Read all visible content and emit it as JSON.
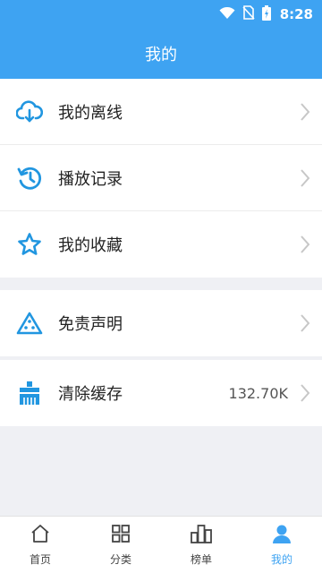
{
  "status": {
    "time": "8:28"
  },
  "header": {
    "title": "我的"
  },
  "menu_group1": [
    {
      "label": "我的离线",
      "icon": "cloud-download-icon"
    },
    {
      "label": "播放记录",
      "icon": "history-icon"
    },
    {
      "label": "我的收藏",
      "icon": "star-icon"
    }
  ],
  "menu_group2": [
    {
      "label": "免责声明",
      "icon": "warning-icon"
    }
  ],
  "menu_group3": [
    {
      "label": "清除缓存",
      "icon": "broom-icon",
      "value": "132.70K"
    }
  ],
  "tabs": [
    {
      "label": "首页",
      "icon": "home-icon"
    },
    {
      "label": "分类",
      "icon": "grid-icon"
    },
    {
      "label": "榜单",
      "icon": "bar-chart-icon"
    },
    {
      "label": "我的",
      "icon": "person-icon",
      "active": true
    }
  ],
  "colors": {
    "accent": "#3ea3f2",
    "icon_blue": "#2196e0",
    "background": "#eff0f4"
  }
}
